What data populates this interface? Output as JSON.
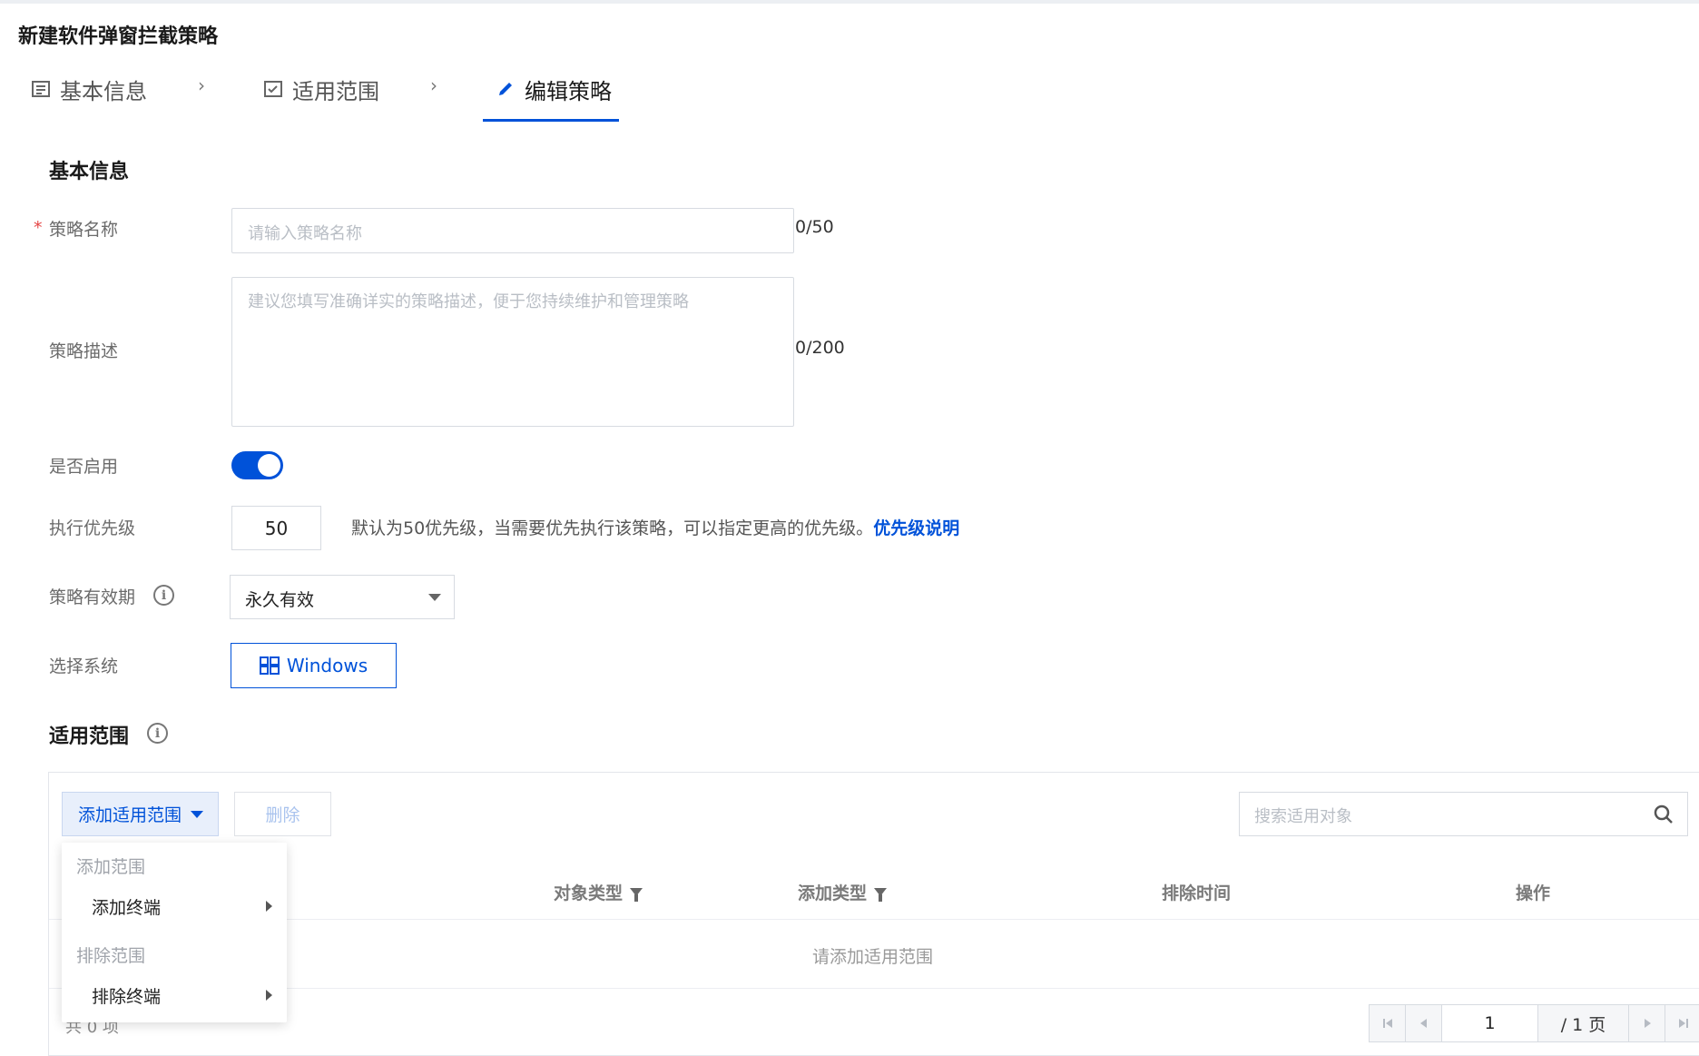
{
  "page_title": "新建软件弹窗拦截策略",
  "steps": [
    {
      "label": "基本信息",
      "icon": "list-icon",
      "active": false
    },
    {
      "label": "适用范围",
      "icon": "checklist-icon",
      "active": false
    },
    {
      "label": "编辑策略",
      "icon": "pencil-icon",
      "active": true
    }
  ],
  "basic_section": {
    "title": "基本信息",
    "name_label": "策略名称",
    "name_placeholder": "请输入策略名称",
    "name_counter": "0/50",
    "desc_label": "策略描述",
    "desc_placeholder": "建议您填写准确详实的策略描述，便于您持续维护和管理策略",
    "desc_counter": "0/200",
    "enable_label": "是否启用",
    "enabled": true,
    "priority_label": "执行优先级",
    "priority_value": "50",
    "priority_hint": "默认为50优先级，当需要优先执行该策略，可以指定更高的优先级。",
    "priority_link": "优先级说明",
    "validity_label": "策略有效期",
    "validity_value": "永久有效",
    "system_label": "选择系统",
    "system_button": "Windows"
  },
  "scope_section": {
    "title": "适用范围",
    "add_button": "添加适用范围",
    "delete_button": "删除",
    "search_placeholder": "搜索适用对象",
    "columns": [
      "对象类型",
      "添加类型",
      "排除时间",
      "操作"
    ],
    "empty_text": "请添加适用范围",
    "total_text": "共 0 项",
    "pagination": {
      "current": "1",
      "total": "/ 1 页"
    },
    "dropdown": {
      "group_add": "添加范围",
      "item_add_terminal": "添加终端",
      "group_exclude": "排除范围",
      "item_exclude_terminal": "排除终端"
    }
  },
  "colors": {
    "accent": "#0052d9",
    "required": "#e54545"
  }
}
